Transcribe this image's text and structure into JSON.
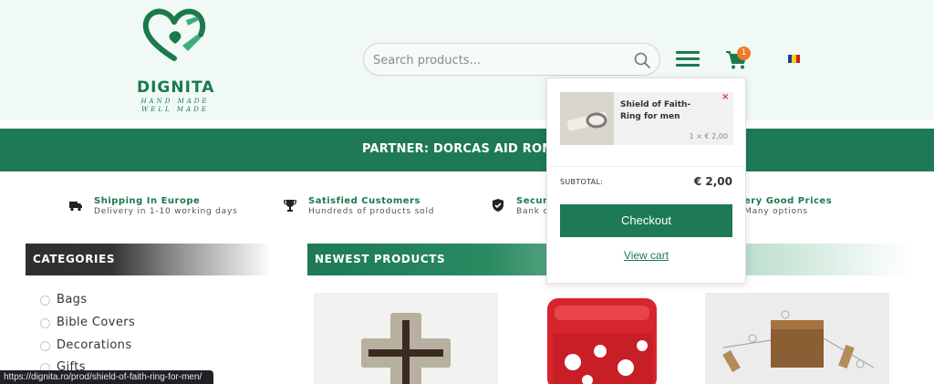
{
  "header": {
    "logo": {
      "name": "DIGNITA",
      "tagline_line1": "HAND MADE",
      "tagline_line2": "WELL MADE"
    },
    "search": {
      "placeholder": "Search products..."
    },
    "cart": {
      "count": "1"
    },
    "flag_colors": [
      "#1d3a9c",
      "#f4d10a",
      "#cc1f2a"
    ],
    "icons": [
      "search-icon",
      "hamburger-menu-icon",
      "shopping-cart-icon",
      "romania-flag-icon"
    ]
  },
  "banner": {
    "text": "PARTNER: DORCAS AID ROMA"
  },
  "features": [
    {
      "icon": "truck-icon",
      "title": "Shipping In Europe",
      "subtitle": "Delivery in 1-10 working days"
    },
    {
      "icon": "trophy-icon",
      "title": "Satisfied Customers",
      "subtitle": "Hundreds of products sold"
    },
    {
      "icon": "shield-check-icon",
      "title": "Secur",
      "subtitle": "Bank c"
    },
    {
      "icon": "",
      "title": "ery Good Prices",
      "subtitle": "Many options"
    }
  ],
  "categories": {
    "title": "CATEGORIES",
    "items": [
      "Bags",
      "Bible Covers",
      "Decorations",
      "Gifts"
    ]
  },
  "newest": {
    "title": "NEWEST PRODUCTS"
  },
  "minicart": {
    "item_name": "Shield of Faith- Ring for men",
    "remove": "×",
    "qty_price": "1 × € 2,00",
    "subtotal_label": "SUBTOTAL:",
    "subtotal_value": "€ 2,00",
    "checkout": "Checkout",
    "view_cart": "View cart"
  },
  "status_url": "https://dignita.ro/prod/shield-of-faith-ring-for-men/",
  "colors": {
    "brand_green": "#1d7a54",
    "badge_orange": "#f07a22",
    "header_bg": "#f1f9f6"
  }
}
